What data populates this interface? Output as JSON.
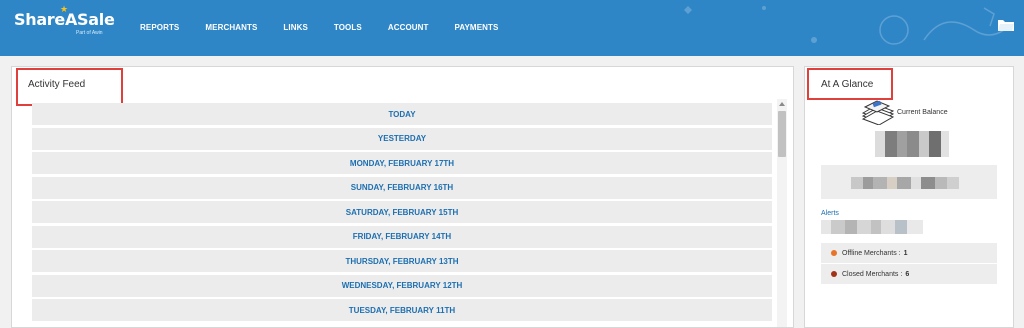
{
  "brand": {
    "name": "ShareASale",
    "subtitle": "Part of Awin",
    "color": "#2f86c7"
  },
  "nav": [
    {
      "label": "REPORTS"
    },
    {
      "label": "MERCHANTS"
    },
    {
      "label": "LINKS"
    },
    {
      "label": "TOOLS"
    },
    {
      "label": "ACCOUNT"
    },
    {
      "label": "PAYMENTS"
    }
  ],
  "header_icons": [
    "folder-icon"
  ],
  "activity_feed": {
    "title": "Activity Feed",
    "days": [
      {
        "label": "TODAY"
      },
      {
        "label": "YESTERDAY"
      },
      {
        "label": "MONDAY, FEBRUARY 17TH"
      },
      {
        "label": "SUNDAY, FEBRUARY 16TH"
      },
      {
        "label": "SATURDAY, FEBRUARY 15TH"
      },
      {
        "label": "FRIDAY, FEBRUARY 14TH"
      },
      {
        "label": "THURSDAY, FEBRUARY 13TH"
      },
      {
        "label": "WEDNESDAY, FEBRUARY 12TH"
      },
      {
        "label": "TUESDAY, FEBRUARY 11TH"
      }
    ]
  },
  "at_a_glance": {
    "title": "At A Glance",
    "current_balance_label": "Current Balance",
    "alerts_label": "Alerts",
    "offline": {
      "label": "Offline Merchants :",
      "count": "1",
      "dot_color": "#e8742b"
    },
    "closed": {
      "label": "Closed Merchants :",
      "count": "6",
      "dot_color": "#a33318"
    }
  },
  "highlight_color": "#e0403c"
}
